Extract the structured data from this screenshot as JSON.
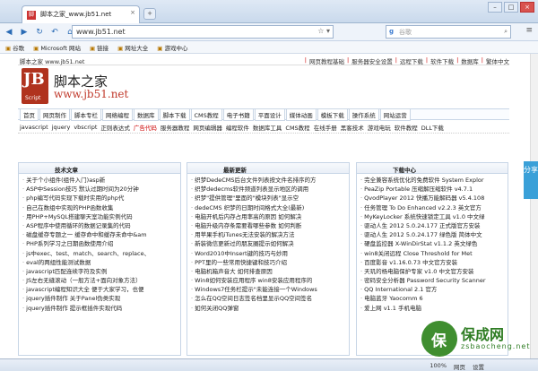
{
  "browser": {
    "tab_title": "脚本之家_www.jb51.net",
    "tab_favicon": "jb51-favicon",
    "url": "www.jb51.net",
    "search_placeholder": "谷歌",
    "bookmarks": [
      "谷歌",
      "Microsoft 网站",
      "链接",
      "网址大全",
      "游戏中心"
    ]
  },
  "site": {
    "url_line": "脚本之家 www.jb51.net",
    "top_links": [
      "网页教程基础",
      "服务器安全设置",
      "远程下载",
      "软件下载",
      "数据库",
      "繁体中文"
    ],
    "logo_letters": "JB",
    "logo_script": "Script",
    "brand_name": "脚本之家",
    "domain": "www.jb51.net",
    "main_nav": [
      "首页",
      "网页制作",
      "脚本专栏",
      "网络编程",
      "数据库",
      "脚本下载",
      "CMS教程",
      "电子书籍",
      "平面设计",
      "媒体动画",
      "模板下载",
      "操作系统",
      "网站运营"
    ],
    "sub_nav": [
      "javascript",
      "jquery",
      "vbscript",
      "正则表达式",
      "广告代码",
      "服务器教程",
      "网页编辑器",
      "编程软件",
      "数据库工具",
      "CMS教程",
      "在线手册",
      "黑客技术",
      "游戏电玩",
      "软件教程",
      "DLL下载"
    ],
    "sub_nav_red_index": 4
  },
  "columns": [
    {
      "title": "技术文章",
      "items": [
        "关于个小组件(组件入门)asp新",
        "ASP中Session技巧 默认过期时间为20分钟",
        "php编写代码实现下载时实用的php代",
        "自己在数组中实现的PHP函数收集",
        "用PHP+MySQL搭建聊天室功能实例代码",
        "ASP程序中使用循环的数据记录集的代码",
        "磁盘缓存专题之一 缓存命中和缓存未命中&am",
        "PHP系列学习之日期函数使用介绍",
        "js中exec、test、match、search、replace、",
        "eval的两组性能测试数据",
        "javascript匹配连续字符及实例",
        "JS左右无缝滚动（一般方法+面向对象方法）",
        "javascript编程知识大全 便于大家学习，也便",
        "jquery插件制作 关于Panel伪类实现",
        "jquery插件制作 提示框插件实现代码"
      ]
    },
    {
      "title": "最新更新",
      "items": [
        "织梦DedeCMS后台文件列表按文件名排序的方",
        "织梦dedecms软件频道列表显示地区的调用",
        "织梦\"提供管理\"里面的\"模块列表\"显示空",
        "dedeCMS 织梦的日期时间格式大全(最新)",
        "电脑开机后内存占用率高的原因 如何解决",
        "电脑升级内存条需要看哪些参数 如何判断",
        "用苹果手机iTunes无法安装的解决方法",
        "新装微信更新过的朋友圈提示如何解决",
        "Word2010中Insert键的技巧与妙用",
        "PPT里的一些常用快捷键和技巧介绍",
        "电脑机箱声音大 如何排查原因",
        "Win8如何安装应用程序 win8安装应用程序的",
        "Windows7任务栏提示\"未能连接一个Windows",
        "怎么在QQ空间日志签名档里显示QQ空间签名",
        "如何关闭QQ弹窗"
      ]
    },
    {
      "title": "下载中心",
      "items": [
        "完全兼容系统优化的免费软件 System Explor",
        "PeaZip Portable 压缩解压缩软件 v4.7.1",
        "QvodPlayer 2012 快播万能解码器 v5.4.108",
        "任务管理 To Do Enhanced v2.2.3 英文官方",
        "MyKeyLocker 系统快速锁定工具 v1.0 中文绿",
        "驱动人生 2012 5.0.24.177 正式版官方安装",
        "驱动人生 2012 5.0.24.177 绿色版 简体中文",
        "硬盘监控器 X-WinDirStat v1.1.2 英文绿色",
        "win8关闭远程 Close Threshold for Met",
        "百度影音 v1.16.0.73 中文官方安装",
        "天玑的杨电脑保护专家 v1.0 中文官方安装",
        "密码安全分析器 Password Security Scanner",
        "QQ International 2.1 官方",
        "电脑蓝牙 Yaocomm 6",
        "爱上网 v1.1 手机电脑"
      ]
    }
  ],
  "share_button": "分享",
  "status_items": [
    "100%",
    "网页",
    "设置"
  ],
  "watermark": {
    "logo": "保",
    "name": "保成网",
    "url": "zsbaocheng.net"
  }
}
